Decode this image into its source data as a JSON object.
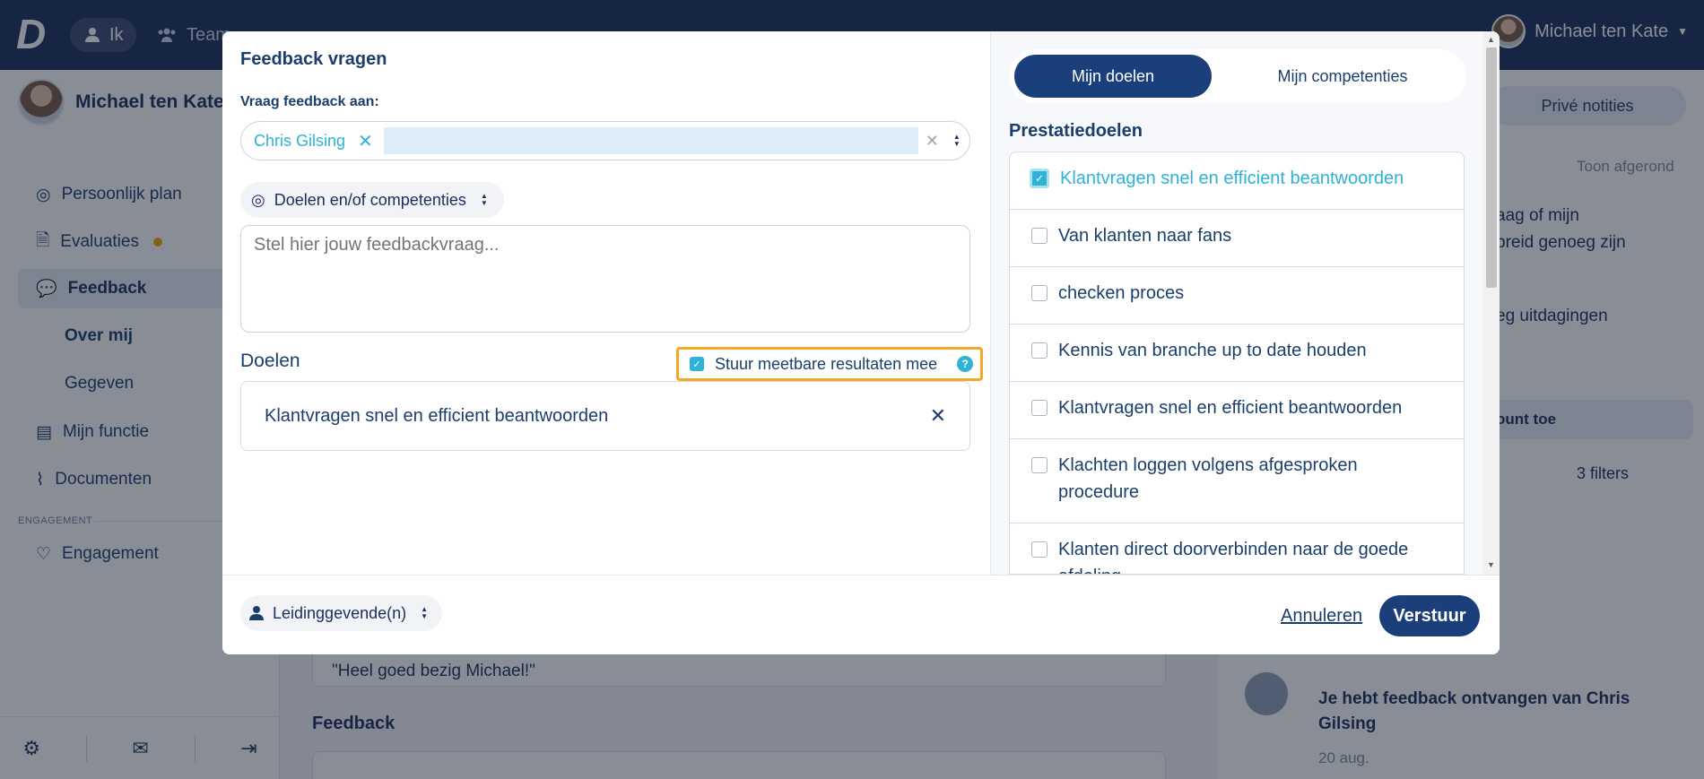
{
  "topbar": {
    "logo": "D",
    "ik_label": "Ik",
    "team_label": "Team",
    "user_name": "Michael ten Kate"
  },
  "sidebar": {
    "user_name": "Michael ten Kate",
    "items": [
      {
        "label": "Persoonlijk plan"
      },
      {
        "label": "Evaluaties"
      },
      {
        "label": "Feedback"
      },
      {
        "label": "Mijn functie"
      },
      {
        "label": "Documenten"
      },
      {
        "label": "Engagement"
      }
    ],
    "sub_items": [
      {
        "label": "Over mij"
      },
      {
        "label": "Gegeven"
      }
    ],
    "section_label": "ENGAGEMENT"
  },
  "background": {
    "quote": "\"Heel goed bezig Michael!\"",
    "feedback_heading": "Feedback",
    "private_notes": "Privé notities",
    "show_completed": "Toon afgerond",
    "snippet_1a": "aag of mijn",
    "snippet_1b": "breid genoeg zijn",
    "snippet_2": "eg uitdagingen",
    "snippet_3": "ount toe",
    "filters": "3 filters",
    "notification_text": "Je hebt feedback ontvangen van Chris Gilsing",
    "notification_date": "20 aug."
  },
  "modal": {
    "title": "Feedback vragen",
    "ask_label": "Vraag feedback aan:",
    "selected_person": "Chris Gilsing",
    "type_chip": "Doelen en/of competenties",
    "textarea_placeholder": "Stel hier jouw feedbackvraag...",
    "goals_heading": "Doelen",
    "measurable_label": "Stuur meetbare resultaten mee",
    "selected_goal": "Klantvragen snel en efficient beantwoorden",
    "tabs": [
      {
        "label": "Mijn doelen"
      },
      {
        "label": "Mijn competenties"
      }
    ],
    "performance_heading": "Prestatiedoelen",
    "goal_list": [
      {
        "label": "Klantvragen snel en efficient beantwoorden",
        "checked": true
      },
      {
        "label": "Van klanten naar fans",
        "checked": false
      },
      {
        "label": "checken proces",
        "checked": false
      },
      {
        "label": "Kennis van branche up to date houden",
        "checked": false
      },
      {
        "label": "Klantvragen snel en efficient beantwoorden",
        "checked": false
      },
      {
        "label": "Klachten loggen volgens afgesproken procedure",
        "checked": false
      },
      {
        "label": "Klanten direct doorverbinden naar de goede afdeling",
        "checked": false
      }
    ],
    "role_chip": "Leidinggevende(n)",
    "cancel_label": "Annuleren",
    "send_label": "Verstuur"
  },
  "colors": {
    "navy": "#1b2e5c",
    "accent": "#2eb2d8",
    "highlight": "#f5a623"
  }
}
